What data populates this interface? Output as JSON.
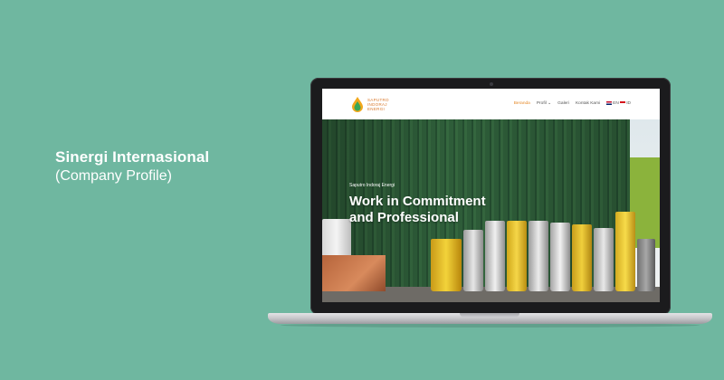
{
  "caption": {
    "title": "Sinergi Internasional",
    "subtitle": "(Company Profile)"
  },
  "website": {
    "logo": {
      "line1": "SAPUTRO",
      "line2": "INDORAJ",
      "line3": "ENERGI",
      "icon": "flame-drop-logo-icon"
    },
    "nav": {
      "items": [
        "Beranda",
        "Profil",
        "Galeri",
        "Kontak Kami"
      ],
      "active": "Beranda",
      "lang_en": "EN",
      "lang_id": "ID"
    },
    "hero": {
      "kicker": "Saputro Indoraj Energi",
      "title_line1": "Work in Commitment",
      "title_line2": "and Professional"
    }
  },
  "colors": {
    "background": "#6fb7a0",
    "accent": "#e58a2a",
    "laptop_bezel": "#1b1b1d"
  }
}
